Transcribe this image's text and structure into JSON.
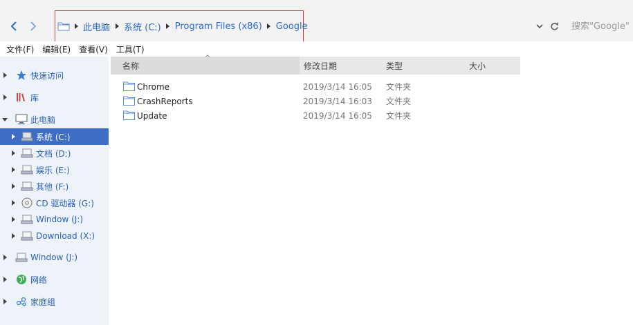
{
  "nav": {
    "back_icon": "chevron-left-icon",
    "forward_icon": "chevron-right-icon"
  },
  "breadcrumb": {
    "root_icon": "folder-icon",
    "items": [
      "此电脑",
      "系统 (C:)",
      "Program Files (x86)",
      "Google"
    ],
    "highlight_color": "#d93b3b"
  },
  "toolbar": {
    "dropdown_icon": "chevron-down-icon",
    "refresh_icon": "refresh-icon"
  },
  "search": {
    "placeholder": "搜索\"Google\""
  },
  "menu": {
    "items": [
      "文件(F)",
      "编辑(E)",
      "查看(V)",
      "工具(T)"
    ]
  },
  "sidebar": {
    "items": [
      {
        "label": "快速访问",
        "icon": "star-icon"
      },
      {
        "label": "库",
        "icon": "library-icon"
      },
      {
        "label": "此电脑",
        "icon": "computer-icon"
      },
      {
        "label": "系统 (C:)",
        "icon": "drive-icon",
        "selected": true
      },
      {
        "label": "文档 (D:)",
        "icon": "drive-icon"
      },
      {
        "label": "娱乐 (E:)",
        "icon": "drive-icon"
      },
      {
        "label": "其他 (F:)",
        "icon": "drive-icon"
      },
      {
        "label": "CD 驱动器 (G:)",
        "icon": "cd-drive-icon"
      },
      {
        "label": "Window (J:)",
        "icon": "drive-icon"
      },
      {
        "label": "Download (X:)",
        "icon": "drive-icon"
      },
      {
        "label": "Window (J:)",
        "icon": "drive-icon"
      },
      {
        "label": "网络",
        "icon": "network-icon"
      },
      {
        "label": "家庭组",
        "icon": "homegroup-icon"
      }
    ],
    "accent_color": "#3d6dc5"
  },
  "columns": {
    "name": "名称",
    "date": "修改日期",
    "type": "类型",
    "size": "大小"
  },
  "files": [
    {
      "name": "Chrome",
      "date": "2019/3/14 16:05",
      "type": "文件夹"
    },
    {
      "name": "CrashReports",
      "date": "2019/3/14 16:03",
      "type": "文件夹"
    },
    {
      "name": "Update",
      "date": "2019/3/14 16:05",
      "type": "文件夹"
    }
  ]
}
